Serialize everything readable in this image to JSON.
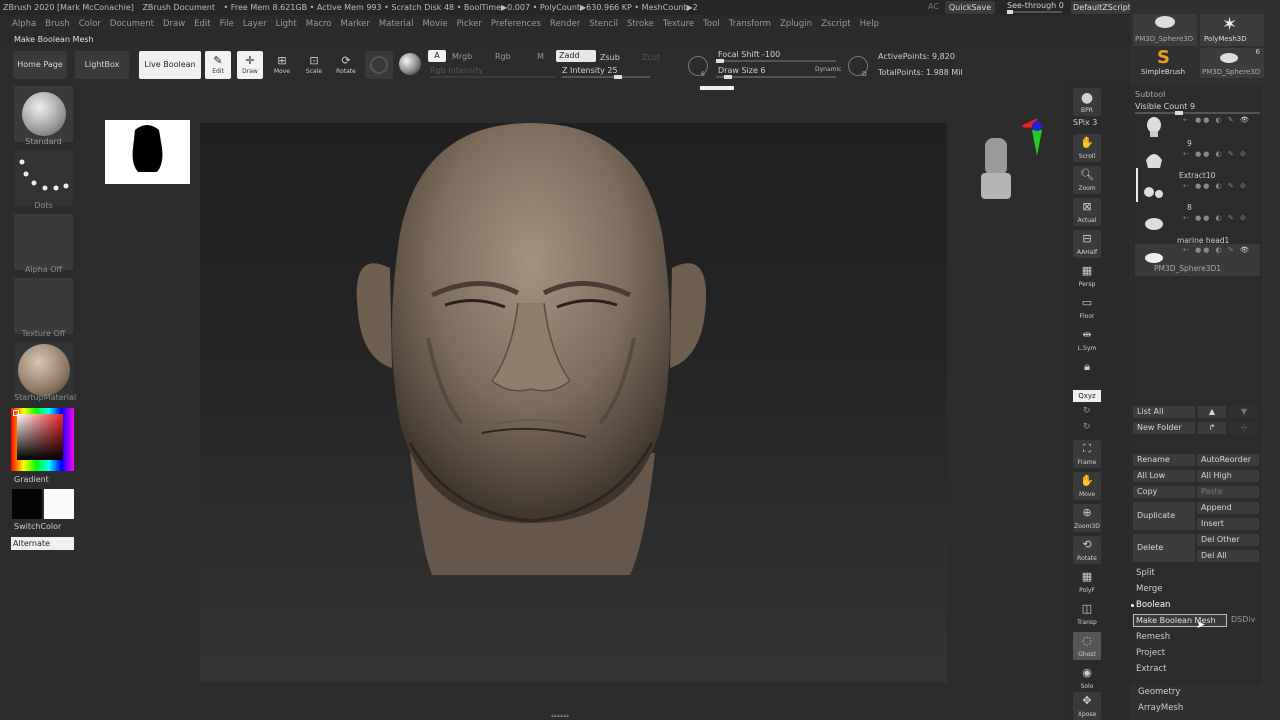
{
  "titlebar": {
    "app": "ZBrush 2020 [Mark McConachie]",
    "document": "ZBrush Document",
    "stats": "• Free Mem 8.621GB • Active Mem 993 • Scratch Disk 48 • BoolTime▶0.007 • PolyCount▶630.966 KP • MeshCount▶2",
    "ac": "AC",
    "quicksave": "QuickSave",
    "seethrough": "See-through 0",
    "script": "DefaultZScript"
  },
  "menu": [
    "Alpha",
    "Brush",
    "Color",
    "Document",
    "Draw",
    "Edit",
    "File",
    "Layer",
    "Light",
    "Macro",
    "Marker",
    "Material",
    "Movie",
    "Picker",
    "Preferences",
    "Render",
    "Stencil",
    "Stroke",
    "Texture",
    "Tool",
    "Transform",
    "Zplugin",
    "Zscript",
    "Help"
  ],
  "tooltip": "Make Boolean Mesh",
  "toolbar": {
    "home": "Home Page",
    "lightbox": "LightBox",
    "live_boolean": "Live Boolean",
    "edit": "Edit",
    "draw": "Draw",
    "move": "Move",
    "scale": "Scale",
    "rotate": "Rotate",
    "a": "A",
    "mrgb": "Mrgb",
    "rgb": "Rgb",
    "m": "M",
    "zadd": "Zadd",
    "zsub": "Zsub",
    "zcut": "Zcut",
    "rgb_intensity": "Rgb Intensity",
    "z_intensity": "Z Intensity 25",
    "focal_shift": "Focal Shift -100",
    "draw_size": "Draw Size 6",
    "dynamic": "Dynamic",
    "s_label": "S",
    "d_label": "D",
    "active_points": "ActivePoints: 9,820",
    "total_points": "TotalPoints: 1.988 Mil"
  },
  "leftshelf": {
    "standard": "Standard",
    "dots": "Dots",
    "alpha_off": "Alpha Off",
    "texture_off": "Texture Off",
    "material": "StartupMaterial",
    "gradient": "Gradient",
    "switchcolor": "SwitchColor",
    "alternate": "Alternate"
  },
  "rightshelf": {
    "bpr": "BPR",
    "spix": "SPix 3",
    "scroll": "Scroll",
    "zoom": "Zoom",
    "actual": "Actual",
    "aahalf": "AAHalf",
    "persp": "Persp",
    "floor": "Floor",
    "lsym": "L.Sym",
    "xyz": "Qxyz",
    "frame": "Frame",
    "move": "Move",
    "zoom3d": "Zoom3D",
    "rotate": "Rotate",
    "polyf": "PolyF",
    "transp": "Transp",
    "ghost": "Ghost",
    "solo": "Solo",
    "xpose": "Xpose"
  },
  "panel": {
    "tools_top": [
      "PM3D_Sphere3D",
      "PolyMesh3D",
      "SimpleBrush",
      "PM3D_Sphere3D"
    ],
    "tool_count": "6",
    "subtool_header": "Subtool",
    "visible_count": "Visible Count 9",
    "subtools": [
      {
        "name": ""
      },
      {
        "name": "9"
      },
      {
        "name": "Extract10"
      },
      {
        "name": "8"
      },
      {
        "name": "marine head1"
      }
    ],
    "subtool_selected": "PM3D_Sphere3D1",
    "list_all": "List All",
    "new_folder": "New Folder",
    "rename": "Rename",
    "autoreorder": "AutoReorder",
    "all_low": "All Low",
    "all_high": "All High",
    "copy": "Copy",
    "paste": "Paste",
    "duplicate": "Duplicate",
    "append": "Append",
    "insert": "Insert",
    "delete": "Delete",
    "del_other": "Del Other",
    "del_all": "Del All",
    "split": "Split",
    "merge": "Merge",
    "boolean": "Boolean",
    "make_boolean_mesh": "Make Boolean Mesh",
    "dsdiv": "DSDiv",
    "remesh": "Remesh",
    "project": "Project",
    "extract": "Extract",
    "geometry": "Geometry",
    "arraymesh": "ArrayMesh"
  },
  "colors": {
    "accent_orange": "#e8a020",
    "active_white": "#f0f0f0"
  }
}
